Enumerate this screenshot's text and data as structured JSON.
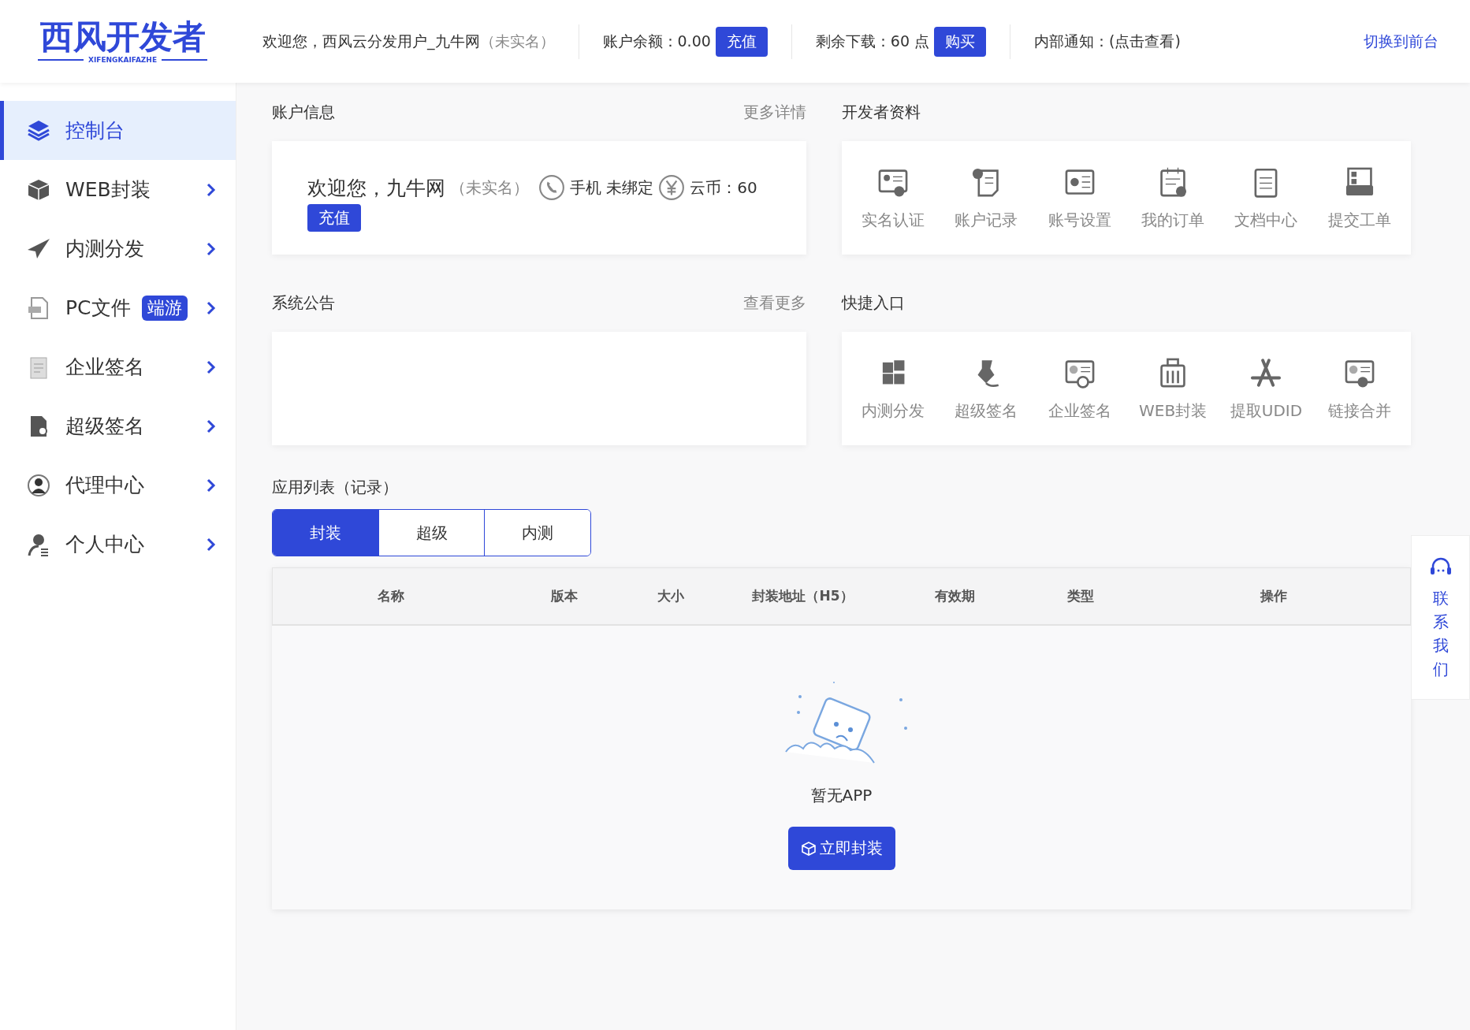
{
  "header": {
    "logo": {
      "title": "西风开发者",
      "subtitle": "XIFENGKAIFAZHE"
    },
    "welcome": "欢迎您，西风云分发用户_九牛网",
    "welcome_status": "（未实名）",
    "balance": "账户余额：0.00",
    "recharge_button": "充值",
    "downloads": "剩余下载：60 点",
    "buy_button": "购买",
    "notice": "内部通知：(点击查看)",
    "switch_link": "切换到前台"
  },
  "sidebar": {
    "items": [
      {
        "label": "控制台",
        "selected": true,
        "expandable": false
      },
      {
        "label": "WEB封装",
        "selected": false,
        "expandable": true
      },
      {
        "label": "内测分发",
        "selected": false,
        "expandable": true
      },
      {
        "label": "PC文件",
        "selected": false,
        "expandable": true,
        "badge": "端游"
      },
      {
        "label": "企业签名",
        "selected": false,
        "expandable": true
      },
      {
        "label": "超级签名",
        "selected": false,
        "expandable": true
      },
      {
        "label": "代理中心",
        "selected": false,
        "expandable": true
      },
      {
        "label": "个人中心",
        "selected": false,
        "expandable": true
      }
    ]
  },
  "account": {
    "title": "账户信息",
    "more": "更多详情",
    "greeting": "欢迎您，九牛网",
    "status": "（未实名）",
    "phone": "手机 未绑定",
    "coins": "云币：60",
    "button": "充值"
  },
  "announcement": {
    "title": "系统公告",
    "more": "查看更多"
  },
  "developer": {
    "title": "开发者资料",
    "items": [
      "实名认证",
      "账户记录",
      "账号设置",
      "我的订单",
      "文档中心",
      "提交工单"
    ]
  },
  "quick_entry": {
    "title": "快捷入口",
    "items": [
      "内测分发",
      "超级签名",
      "企业签名",
      "WEB封装",
      "提取UDID",
      "链接合并"
    ]
  },
  "app_list": {
    "title": "应用列表（记录）",
    "tabs": [
      {
        "label": "封装",
        "selected": true
      },
      {
        "label": "超级",
        "selected": false
      },
      {
        "label": "内测",
        "selected": false
      }
    ],
    "table": {
      "columns": [
        "名称",
        "版本",
        "大小",
        "封装地址（H5）",
        "有效期",
        "类型",
        "操作"
      ]
    },
    "empty_text": "暂无APP",
    "button": "立即封装"
  },
  "contact": "联系我们"
}
